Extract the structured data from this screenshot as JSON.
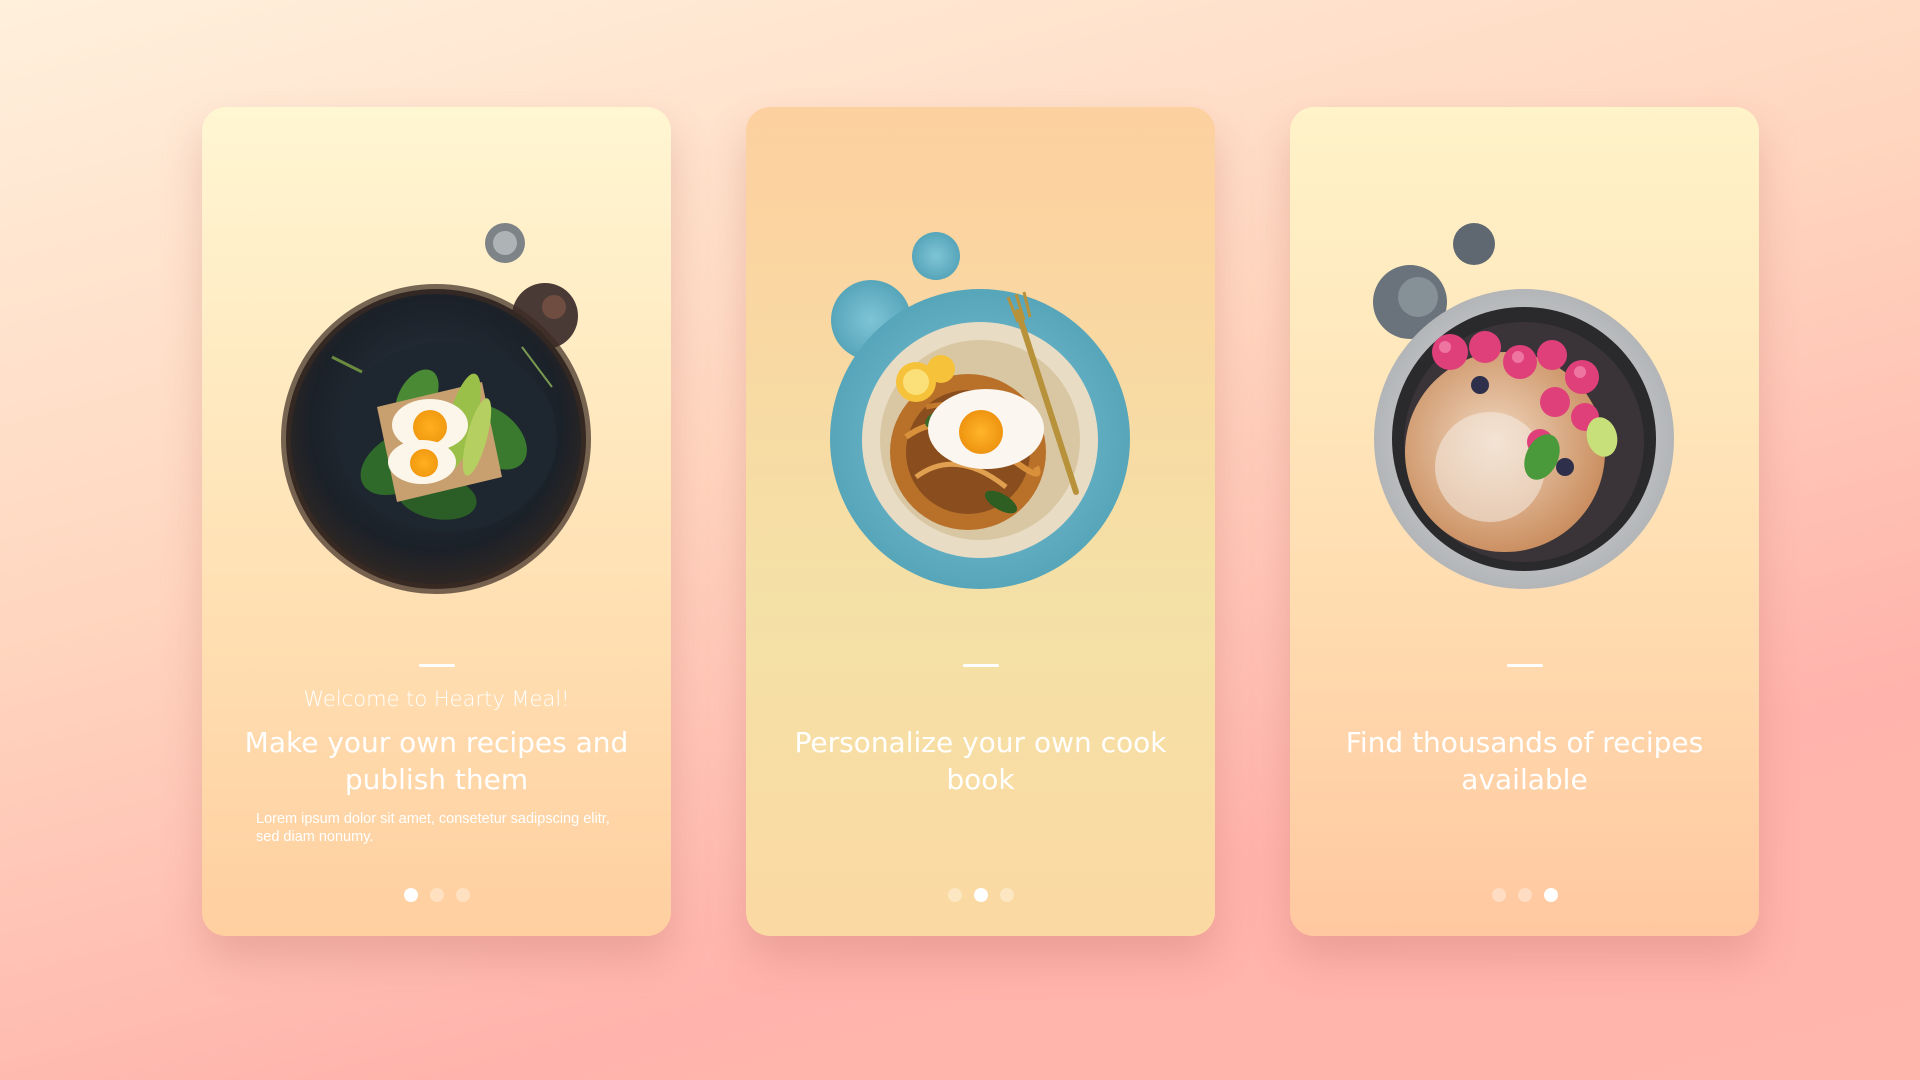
{
  "cards": [
    {
      "welcome": "Welcome to Hearty Meal!",
      "headline": "Make your own recipes and publish them",
      "body": "Lorem ipsum dolor sit amet, consetetur sadipscing elitr, sed diam nonumy.",
      "dots": {
        "count": 3,
        "active": 1
      },
      "hero_icon": "avocado-egg-toast-dish-icon"
    },
    {
      "welcome": "",
      "headline": "Personalize your own cook book",
      "body": "",
      "dots": {
        "count": 3,
        "active": 2
      },
      "hero_icon": "egg-noodle-plate-with-fork-icon"
    },
    {
      "welcome": "",
      "headline": "Find thousands of recipes available",
      "body": "",
      "dots": {
        "count": 3,
        "active": 3
      },
      "hero_icon": "raspberry-pancake-skillet-icon"
    }
  ],
  "colors": {
    "text": "#ffffff",
    "dot_active": "#ffffff",
    "dot_inactive": "rgba(255,255,255,0.35)"
  }
}
